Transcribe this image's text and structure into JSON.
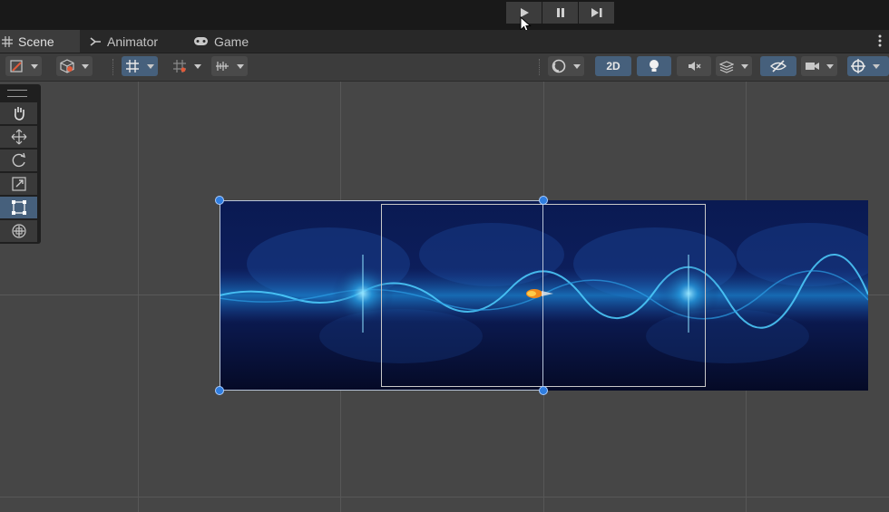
{
  "playbar": {
    "play": "play-icon",
    "pause": "pause-icon",
    "step": "step-icon"
  },
  "tabs": [
    {
      "label": "Scene",
      "icon": "grid-icon"
    },
    {
      "label": "Animator",
      "icon": "animator-icon"
    },
    {
      "label": "Game",
      "icon": "gamepad-icon"
    }
  ],
  "toolbar": {
    "mode_2d_label": "2D"
  },
  "tools": [
    "hand-tool",
    "move-tool",
    "rotate-tool",
    "scale-tool",
    "rect-tool",
    "transform-tool"
  ],
  "colors": {
    "accent": "#46607c",
    "handle": "#2f7de0",
    "scene_bg": "#464646"
  }
}
